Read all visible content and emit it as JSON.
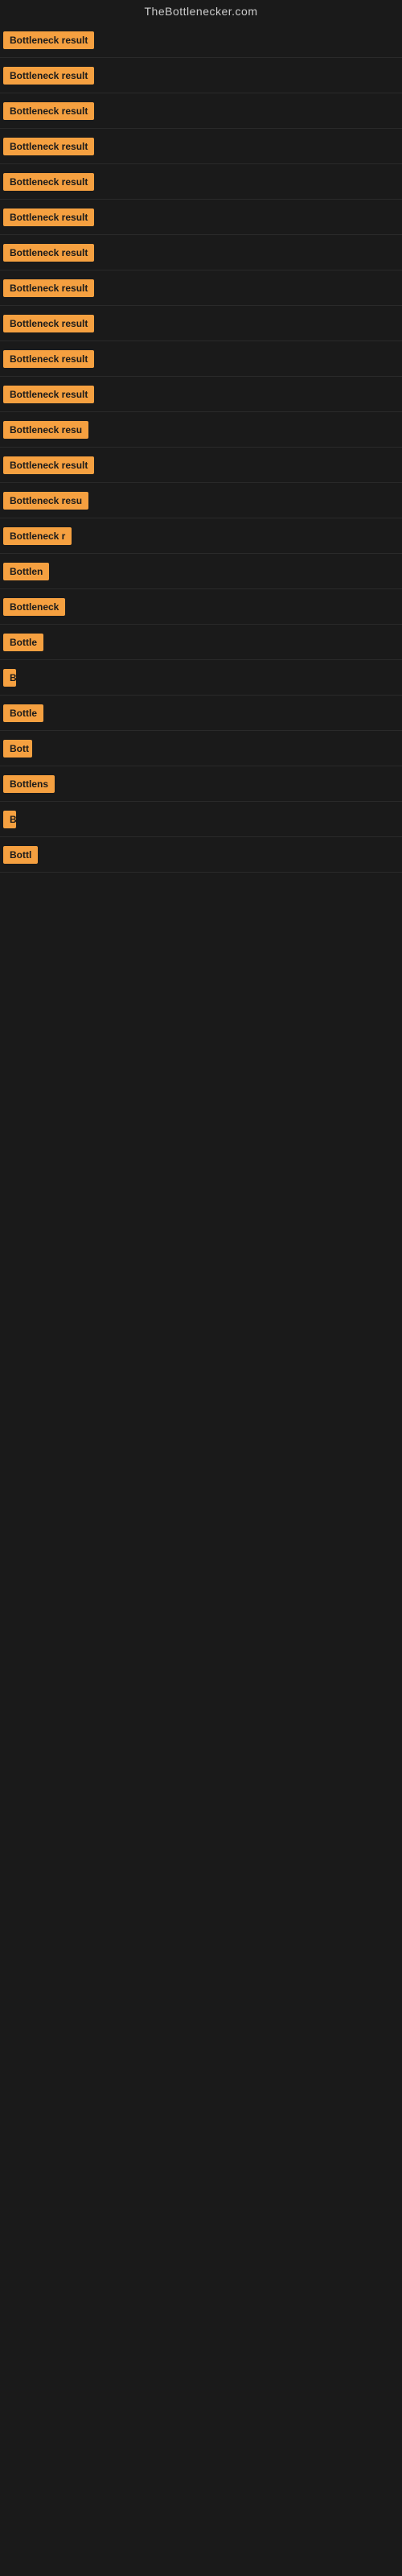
{
  "site": {
    "title": "TheBottlenecker.com"
  },
  "labels": [
    {
      "id": 1,
      "text": "Bottleneck result",
      "width": 120
    },
    {
      "id": 2,
      "text": "Bottleneck result",
      "width": 120
    },
    {
      "id": 3,
      "text": "Bottleneck result",
      "width": 120
    },
    {
      "id": 4,
      "text": "Bottleneck result",
      "width": 120
    },
    {
      "id": 5,
      "text": "Bottleneck result",
      "width": 120
    },
    {
      "id": 6,
      "text": "Bottleneck result",
      "width": 120
    },
    {
      "id": 7,
      "text": "Bottleneck result",
      "width": 120
    },
    {
      "id": 8,
      "text": "Bottleneck result",
      "width": 120
    },
    {
      "id": 9,
      "text": "Bottleneck result",
      "width": 120
    },
    {
      "id": 10,
      "text": "Bottleneck result",
      "width": 120
    },
    {
      "id": 11,
      "text": "Bottleneck result",
      "width": 120
    },
    {
      "id": 12,
      "text": "Bottleneck resu",
      "width": 108
    },
    {
      "id": 13,
      "text": "Bottleneck result",
      "width": 120
    },
    {
      "id": 14,
      "text": "Bottleneck resu",
      "width": 108
    },
    {
      "id": 15,
      "text": "Bottleneck r",
      "width": 88
    },
    {
      "id": 16,
      "text": "Bottlen",
      "width": 62
    },
    {
      "id": 17,
      "text": "Bottleneck",
      "width": 78
    },
    {
      "id": 18,
      "text": "Bottle",
      "width": 52
    },
    {
      "id": 19,
      "text": "B",
      "width": 16
    },
    {
      "id": 20,
      "text": "Bottle",
      "width": 52
    },
    {
      "id": 21,
      "text": "Bott",
      "width": 36
    },
    {
      "id": 22,
      "text": "Bottlens",
      "width": 64
    },
    {
      "id": 23,
      "text": "B",
      "width": 16
    },
    {
      "id": 24,
      "text": "Bottl",
      "width": 44
    }
  ]
}
